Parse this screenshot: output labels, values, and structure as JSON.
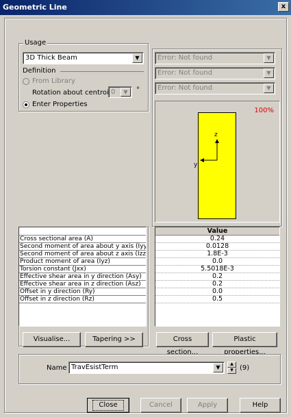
{
  "window": {
    "title": "Geometric Line",
    "close_glyph": "x"
  },
  "usage": {
    "label": "Usage",
    "selected": "3D Thick Beam"
  },
  "definition": {
    "label": "Definition",
    "from_library": "From Library",
    "rotation_label": "Rotation about centroid",
    "rotation_value": "0",
    "degree_symbol": "°",
    "enter_properties": "Enter Properties"
  },
  "library": {
    "combo1": "Error: Not found",
    "combo2": "Error: Not found",
    "combo3": "Error: Not found"
  },
  "preview": {
    "zoom": "100%",
    "axis_z": "z",
    "axis_y": "y",
    "section_color": "#ffff00"
  },
  "properties": {
    "value_header": "Value",
    "names": [
      "Cross sectional area (A)",
      "Second moment of area about y axis (Iyy)",
      "Second moment of area about z axis (Izz)",
      "Product moment of area (Iyz)",
      "Torsion constant (Jxx)",
      "Effective shear area in y direction (Asy)",
      "Effective shear area in z direction (Asz)",
      "Offset in y direction (Ry)",
      "Offset in z direction (Rz)"
    ],
    "values": [
      "0.24",
      "0.0128",
      "1.8E-3",
      "0.0",
      "5.5018E-3",
      "0.2",
      "0.2",
      "0.0",
      "0.5"
    ]
  },
  "buttons": {
    "visualise": "Visualise...",
    "tapering": "Tapering >>",
    "cross_section": "Cross section...",
    "plastic": "Plastic properties..."
  },
  "name_field": {
    "label": "Name",
    "value": "TravEsistTerm",
    "count": "(9)"
  },
  "footer": {
    "close": "Close",
    "cancel": "Cancel",
    "apply": "Apply",
    "help": "Help"
  }
}
